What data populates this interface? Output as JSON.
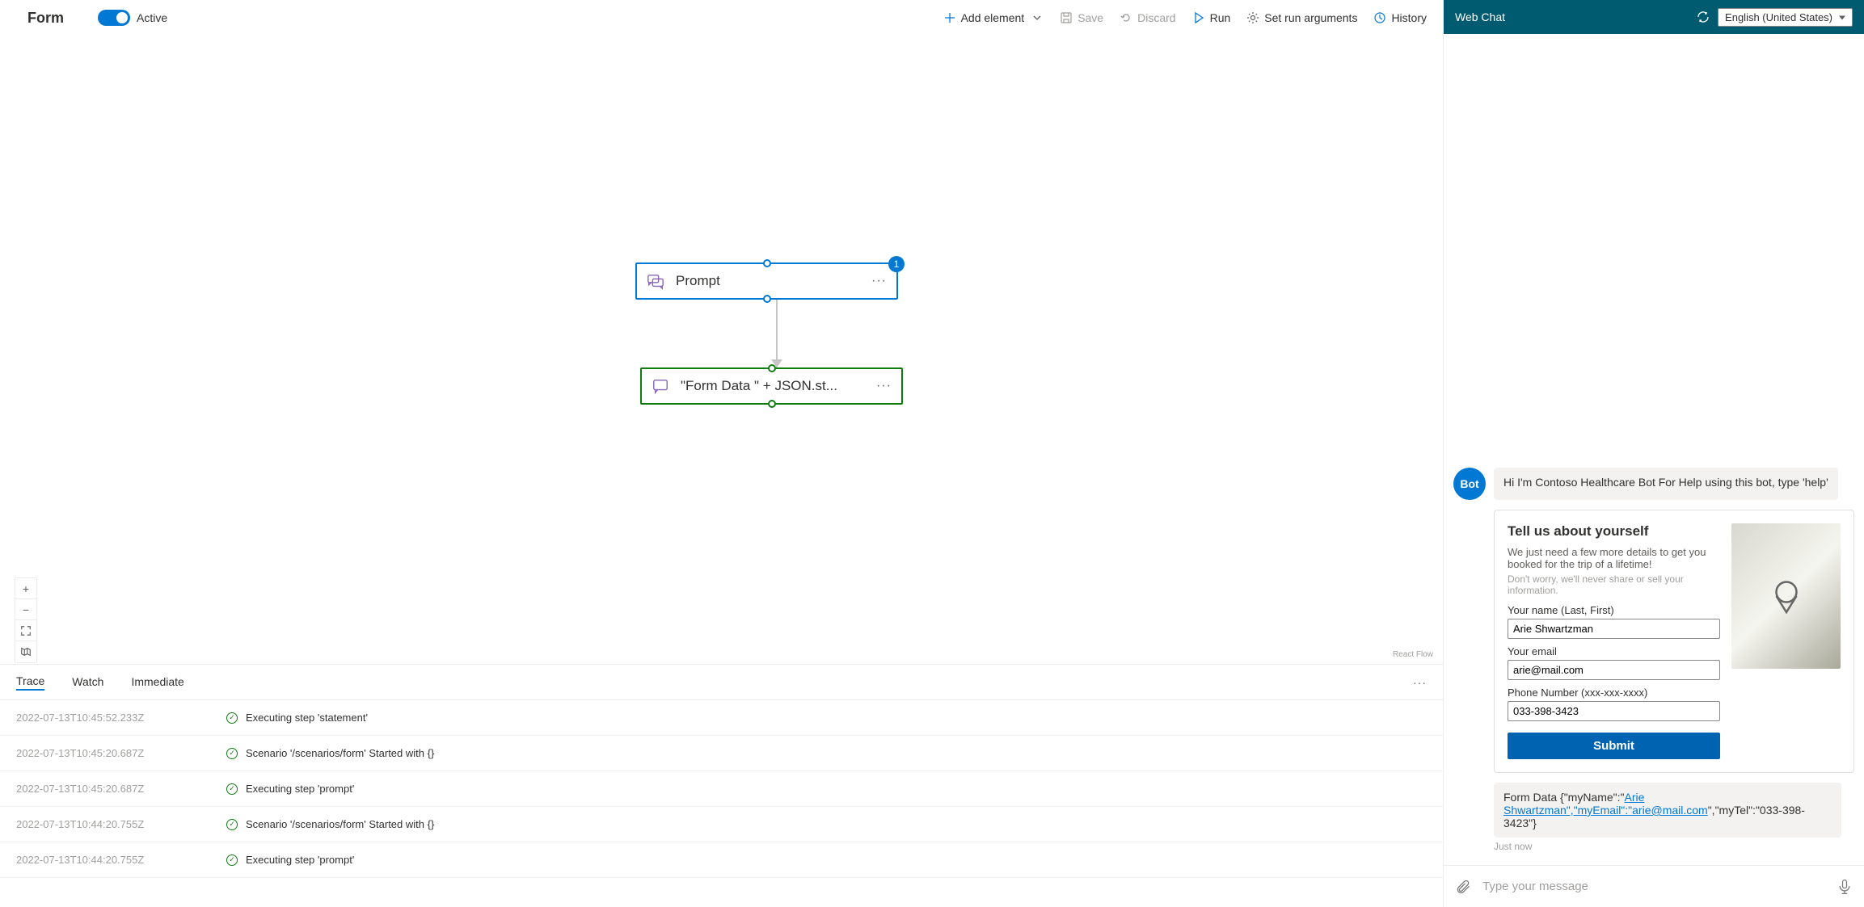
{
  "toolbar": {
    "title": "Form",
    "active_label": "Active",
    "add_element": "Add element",
    "save": "Save",
    "discard": "Discard",
    "run": "Run",
    "set_run_args": "Set run arguments",
    "history": "History"
  },
  "canvas": {
    "node_prompt_label": "Prompt",
    "node_prompt_badge": "1",
    "node_stmt_label": "\"Form Data \" + JSON.st...",
    "attribution": "React Flow"
  },
  "bottom": {
    "tabs": {
      "trace": "Trace",
      "watch": "Watch",
      "immediate": "Immediate"
    },
    "rows": [
      {
        "ts": "2022-07-13T10:45:52.233Z",
        "msg": "Executing step 'statement'"
      },
      {
        "ts": "2022-07-13T10:45:20.687Z",
        "msg": "Scenario '/scenarios/form' Started with {}"
      },
      {
        "ts": "2022-07-13T10:45:20.687Z",
        "msg": "Executing step 'prompt'"
      },
      {
        "ts": "2022-07-13T10:44:20.755Z",
        "msg": "Scenario '/scenarios/form' Started with {}"
      },
      {
        "ts": "2022-07-13T10:44:20.755Z",
        "msg": "Executing step 'prompt'"
      }
    ]
  },
  "chat": {
    "header_title": "Web Chat",
    "language": "English (United States)",
    "bot_avatar": "Bot",
    "greeting": "Hi I'm Contoso Healthcare Bot For Help using this bot, type 'help'",
    "card": {
      "title": "Tell us about yourself",
      "subtitle": "We just need a few more details to get you booked for the trip of a lifetime!",
      "note": "Don't worry, we'll never share or sell your information.",
      "name_label": "Your name (Last, First)",
      "name_value": "Arie Shwartzman",
      "email_label": "Your email",
      "email_value": "arie@mail.com",
      "phone_label": "Phone Number (xxx-xxx-xxxx)",
      "phone_value": "033-398-3423",
      "submit": "Submit"
    },
    "result_prefix": "Form Data {\"myName\":\"",
    "result_link1": "Arie Shwartzman\",\"myEmail\":\"arie@mail.com",
    "result_suffix": "\",\"myTel\":\"033-398-3423\"}",
    "timestamp": "Just now",
    "input_placeholder": "Type your message"
  }
}
